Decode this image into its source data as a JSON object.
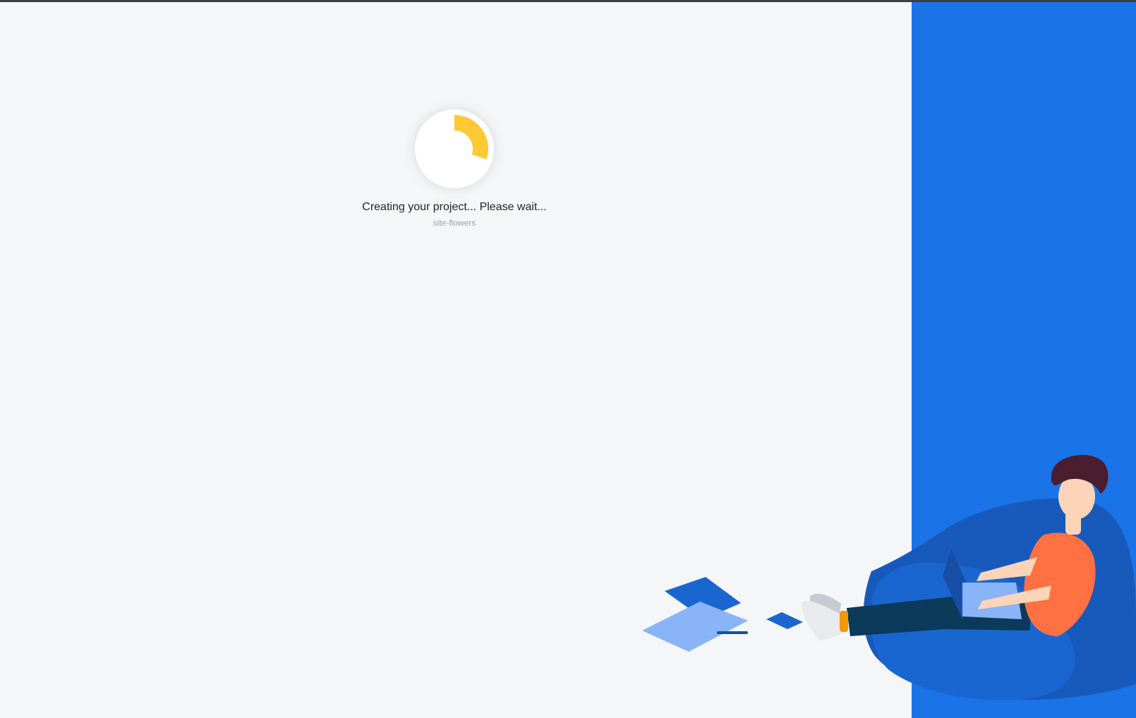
{
  "loader": {
    "progress": 0.3,
    "accent_color": "#fcc934",
    "icon": "progress-spinner-icon"
  },
  "status": {
    "message": "Creating your project... Please wait...",
    "project_name": "site-flowers"
  },
  "theme": {
    "background": "#f4f6f8",
    "panel_color": "#1b73e8"
  },
  "illustration": {
    "icon": "person-with-laptop-illustration"
  }
}
